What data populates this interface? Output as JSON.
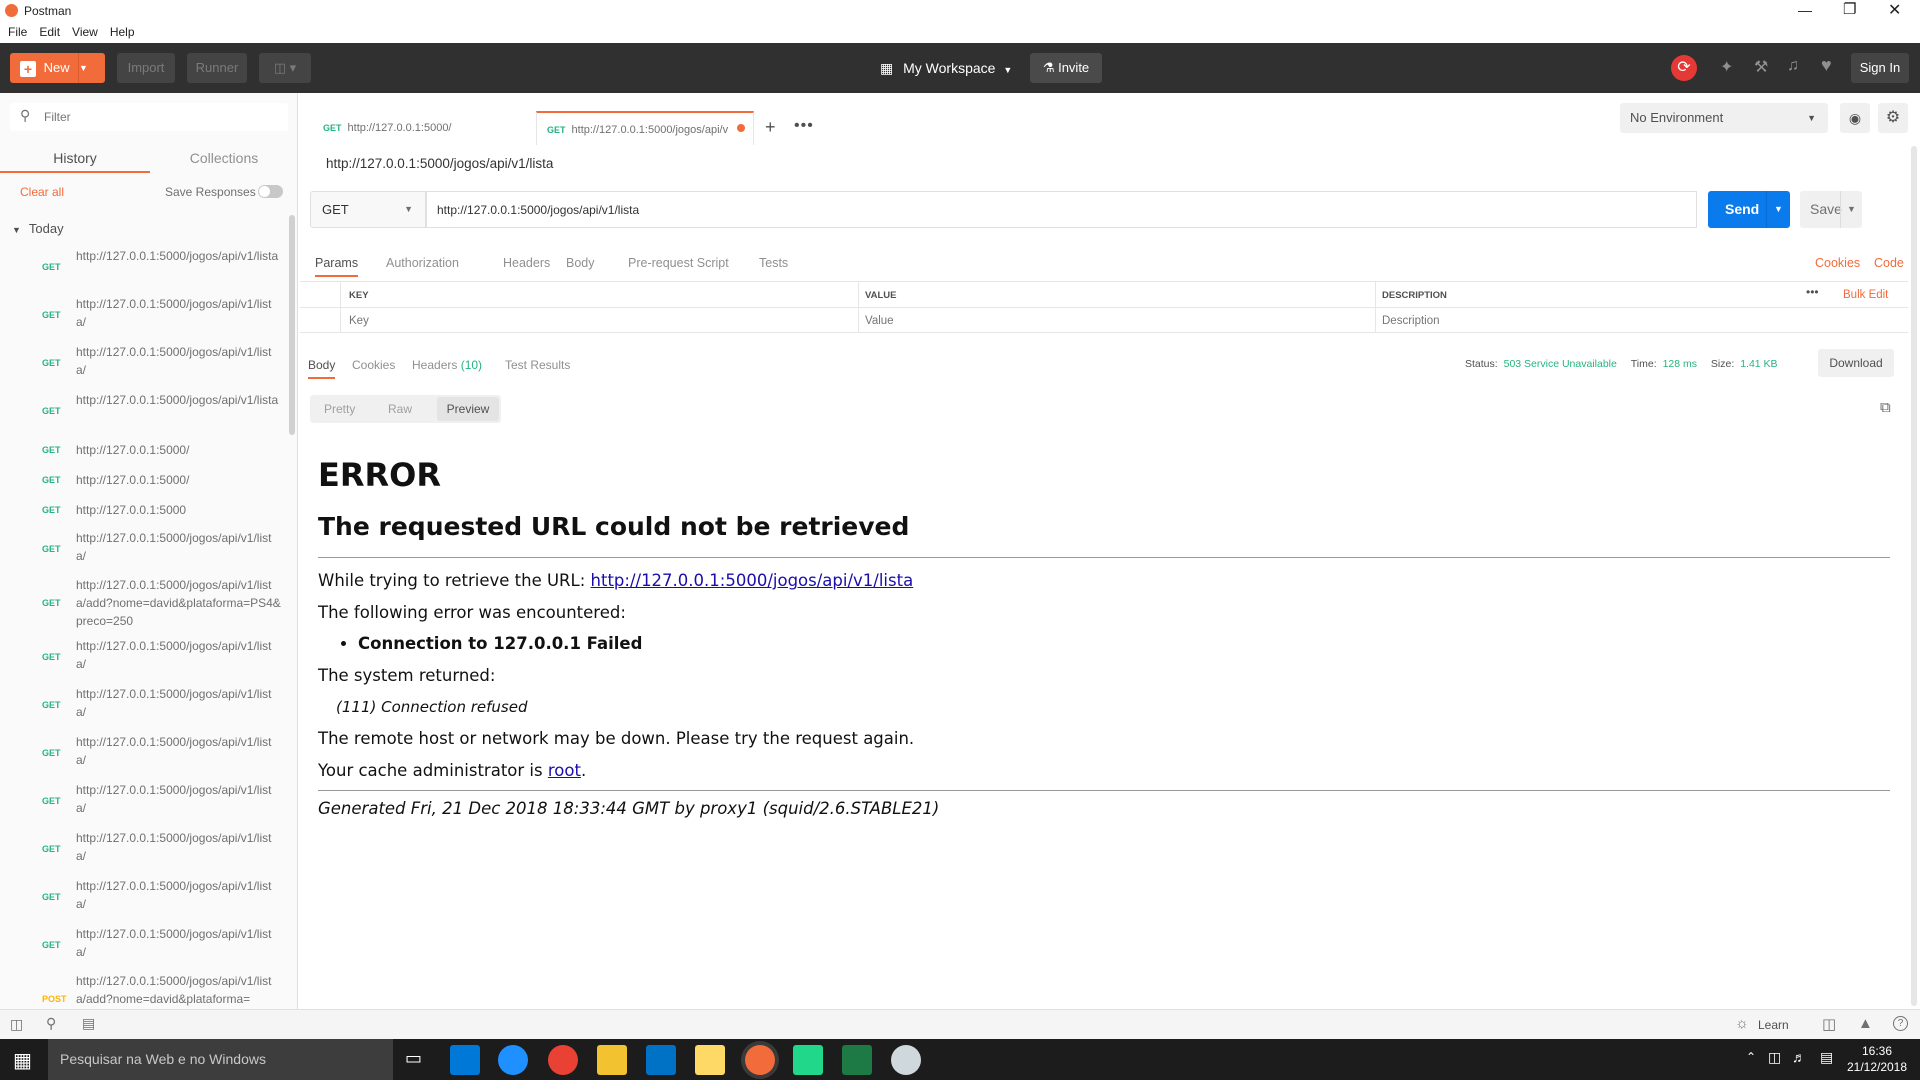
{
  "window": {
    "title": "Postman"
  },
  "menu": [
    "File",
    "Edit",
    "View",
    "Help"
  ],
  "header": {
    "new_label": "New",
    "import_label": "Import",
    "runner_label": "Runner",
    "workspace_label": "My Workspace",
    "invite_label": "Invite",
    "signin_label": "Sign In"
  },
  "sidebar": {
    "filter_placeholder": "Filter",
    "tabs": [
      "History",
      "Collections"
    ],
    "clear_all": "Clear all",
    "save_responses": "Save Responses",
    "group_label": "Today",
    "items": [
      {
        "method": "GET",
        "url": "http://127.0.0.1:5000/jogos/api/v1/lista"
      },
      {
        "method": "GET",
        "url": "http://127.0.0.1:5000/jogos/api/v1/lista/"
      },
      {
        "method": "GET",
        "url": "http://127.0.0.1:5000/jogos/api/v1/lista/"
      },
      {
        "method": "GET",
        "url": "http://127.0.0.1:5000/jogos/api/v1/lista"
      },
      {
        "method": "GET",
        "url": "http://127.0.0.1:5000/"
      },
      {
        "method": "GET",
        "url": "http://127.0.0.1:5000/"
      },
      {
        "method": "GET",
        "url": "http://127.0.0.1:5000"
      },
      {
        "method": "GET",
        "url": "http://127.0.0.1:5000/jogos/api/v1/lista/"
      },
      {
        "method": "GET",
        "url": "http://127.0.0.1:5000/jogos/api/v1/lista/add?nome=david&plataforma=PS4&preco=250"
      },
      {
        "method": "GET",
        "url": "http://127.0.0.1:5000/jogos/api/v1/lista/"
      },
      {
        "method": "GET",
        "url": "http://127.0.0.1:5000/jogos/api/v1/lista/"
      },
      {
        "method": "GET",
        "url": "http://127.0.0.1:5000/jogos/api/v1/lista/"
      },
      {
        "method": "GET",
        "url": "http://127.0.0.1:5000/jogos/api/v1/lista/"
      },
      {
        "method": "GET",
        "url": "http://127.0.0.1:5000/jogos/api/v1/lista/"
      },
      {
        "method": "GET",
        "url": "http://127.0.0.1:5000/jogos/api/v1/lista/"
      },
      {
        "method": "GET",
        "url": "http://127.0.0.1:5000/jogos/api/v1/lista/"
      },
      {
        "method": "POST",
        "url": "http://127.0.0.1:5000/jogos/api/v1/lista/add?nome=david&plataforma="
      }
    ]
  },
  "tabs": [
    {
      "method": "GET",
      "label": "http://127.0.0.1:5000/"
    },
    {
      "method": "GET",
      "label": "http://127.0.0.1:5000/jogos/api/v"
    }
  ],
  "environment": {
    "selected": "No Environment"
  },
  "request": {
    "title": "http://127.0.0.1:5000/jogos/api/v1/lista",
    "method": "GET",
    "url": "http://127.0.0.1:5000/jogos/api/v1/lista",
    "send_label": "Send",
    "save_label": "Save",
    "subtabs": [
      "Params",
      "Authorization",
      "Headers",
      "Body",
      "Pre-request Script",
      "Tests"
    ],
    "cookies_link": "Cookies",
    "code_link": "Code",
    "params": {
      "columns": [
        "KEY",
        "VALUE",
        "DESCRIPTION"
      ],
      "bulk_edit": "Bulk Edit",
      "placeholders": {
        "key": "Key",
        "value": "Value",
        "description": "Description"
      }
    }
  },
  "response": {
    "tabs": {
      "body": "Body",
      "cookies": "Cookies",
      "headers": "Headers",
      "headers_count": "(10)",
      "tests": "Test Results"
    },
    "status_label": "Status:",
    "status_value": "503 Service Unavailable",
    "time_label": "Time:",
    "time_value": "128 ms",
    "size_label": "Size:",
    "size_value": "1.41 KB",
    "download_label": "Download",
    "view_modes": [
      "Pretty",
      "Raw",
      "Preview"
    ],
    "html": {
      "h1": "ERROR",
      "h2": "The requested URL could not be retrieved",
      "p1_text": "While trying to retrieve the URL: ",
      "p1_link": "http://127.0.0.1:5000/jogos/api/v1/lista",
      "p2": "The following error was encountered:",
      "li": "Connection to 127.0.0.1 Failed",
      "p3": "The system returned:",
      "p4": "(111) Connection refused",
      "p5": "The remote host or network may be down. Please try the request again.",
      "p6_text": "Your cache administrator is ",
      "p6_link": "root",
      "p6_end": ".",
      "footer": "Generated Fri, 21 Dec 2018 18:33:44 GMT by proxy1 (squid/2.6.STABLE21)"
    }
  },
  "statusbar": {
    "learn_label": "Learn"
  },
  "taskbar": {
    "search_placeholder": "Pesquisar na Web e no Windows",
    "time": "16:36",
    "date": "21/12/2018"
  },
  "colors": {
    "accent": "#f26b3a",
    "send": "#097bed",
    "get": "#26b47f",
    "post": "#ffb400",
    "status_ok": "#26b47f"
  }
}
